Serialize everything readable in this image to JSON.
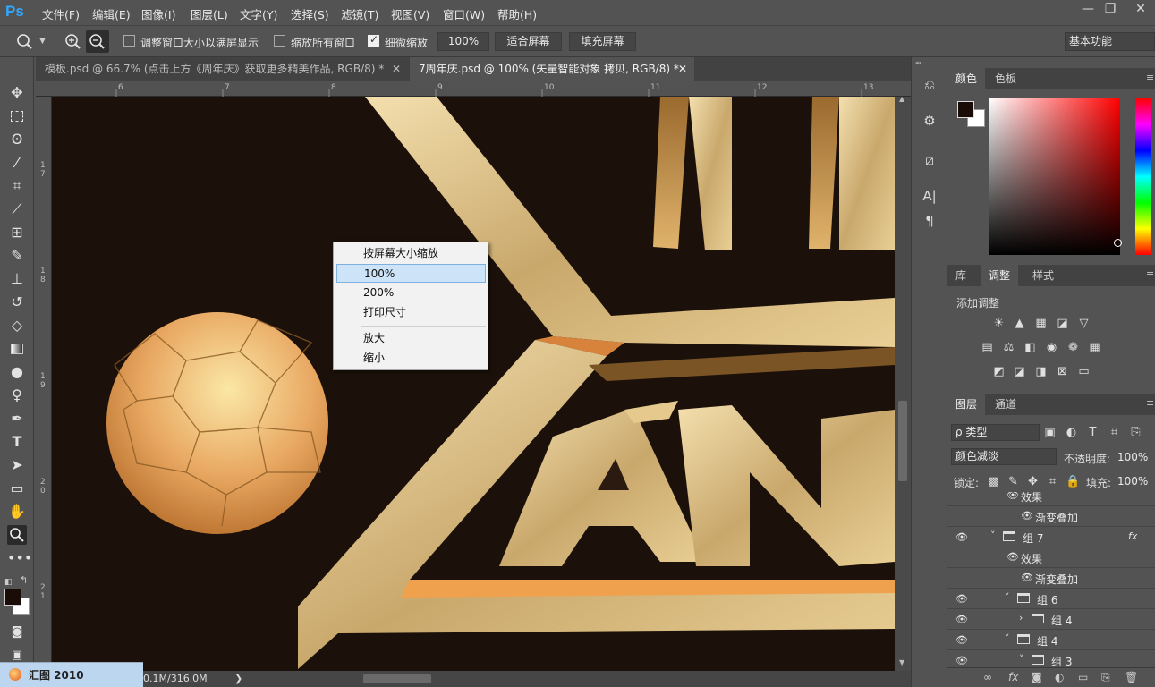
{
  "app": {
    "logo": "Ps"
  },
  "menu": [
    "文件(F)",
    "编辑(E)",
    "图像(I)",
    "图层(L)",
    "文字(Y)",
    "选择(S)",
    "滤镜(T)",
    "视图(V)",
    "窗口(W)",
    "帮助(H)"
  ],
  "window_controls": {
    "minimize": "—",
    "restore": "❐",
    "close": "✕"
  },
  "options": {
    "resize_windows_label": "调整窗口大小以满屏显示",
    "zoom_all_label": "缩放所有窗口",
    "scrubby_zoom_label": "细微缩放",
    "zoom_value": "100%",
    "fit_screen": "适合屏幕",
    "fill_screen": "填充屏幕",
    "workspace": "基本功能",
    "resize_checked": false,
    "zoom_all_checked": false,
    "scrubby_checked": true
  },
  "tabs": [
    {
      "label": "模板.psd @ 66.7% (点击上方《周年庆》获取更多精美作品, RGB/8) *",
      "close": "✕",
      "active": false
    },
    {
      "label": "7周年庆.psd @ 100% (矢量智能对象 拷贝, RGB/8) *",
      "close": "✕",
      "active": true
    }
  ],
  "ruler": {
    "top": [
      "6",
      "7",
      "8",
      "9",
      "10",
      "11",
      "12",
      "13"
    ],
    "left": [
      "1",
      "7",
      "1",
      "8",
      "1",
      "9",
      "2",
      "0",
      "2",
      "1"
    ]
  },
  "context_menu": {
    "items": [
      {
        "label": "按屏幕大小缩放",
        "highlight": false
      },
      {
        "label": "100%",
        "highlight": true
      },
      {
        "label": "200%",
        "highlight": false
      },
      {
        "label": "打印尺寸",
        "highlight": false
      },
      {
        "label": "放大",
        "highlight": false
      },
      {
        "label": "缩小",
        "highlight": false
      }
    ]
  },
  "status": {
    "doc_size": "0.1M/316.0M",
    "arrow": "❯"
  },
  "taskbar": {
    "label": "汇图 2010"
  },
  "color_panel": {
    "tabs": [
      "颜色",
      "色板"
    ],
    "fg": "#1a0d08",
    "bg": "#ffffff"
  },
  "adjust_panel": {
    "tabs": [
      "库",
      "调整",
      "样式"
    ],
    "title": "添加调整"
  },
  "layers_panel": {
    "tabs": [
      "图层",
      "通道"
    ],
    "filter": "ρ 类型",
    "blend_mode": "颜色减淡",
    "opacity_label": "不透明度:",
    "opacity": "100%",
    "lock_label": "锁定:",
    "fill_label": "填充:",
    "fill": "100%",
    "rows": [
      {
        "name": "效果",
        "indent": 1,
        "eye": false,
        "folder": false,
        "twirl": ""
      },
      {
        "name": "渐变叠加",
        "indent": 2,
        "eye": false,
        "folder": false,
        "twirl": ""
      },
      {
        "name": "组 7",
        "indent": 0,
        "eye": true,
        "folder": true,
        "twirl": "˅",
        "fx": "fx"
      },
      {
        "name": "效果",
        "indent": 1,
        "eye": false,
        "folder": false,
        "twirl": ""
      },
      {
        "name": "渐变叠加",
        "indent": 2,
        "eye": false,
        "folder": false,
        "twirl": ""
      },
      {
        "name": "组 6",
        "indent": 1,
        "eye": true,
        "folder": true,
        "twirl": "˅"
      },
      {
        "name": "组 4",
        "indent": 2,
        "eye": true,
        "folder": true,
        "twirl": "›"
      },
      {
        "name": "组 4",
        "indent": 1,
        "eye": true,
        "folder": true,
        "twirl": "˅"
      },
      {
        "name": "组 3",
        "indent": 2,
        "eye": true,
        "folder": true,
        "twirl": "˅"
      }
    ]
  }
}
